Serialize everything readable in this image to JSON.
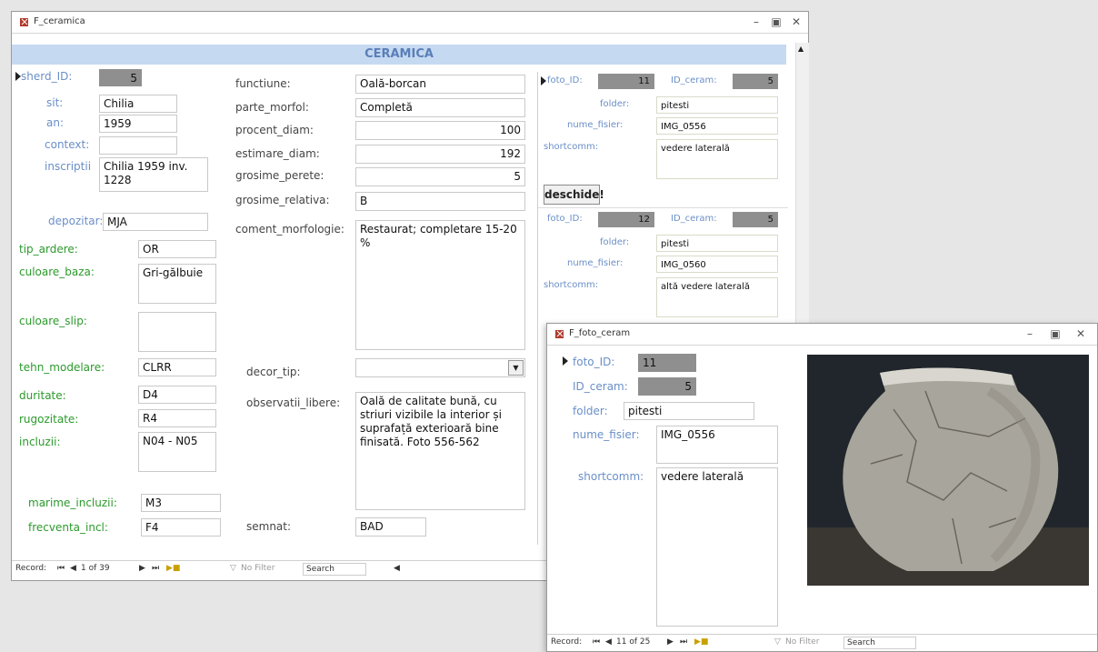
{
  "main_window": {
    "title": "F_ceramica",
    "header": "CERAMICA",
    "fields": {
      "sherd_id_label": "sherd_ID:",
      "sherd_id": "5",
      "sit_label": "sit:",
      "sit": "Chilia",
      "an_label": "an:",
      "an": "1959",
      "context_label": "context:",
      "context": "",
      "inscriptii_label": "inscriptii",
      "inscriptii": "Chilia 1959 inv. 1228",
      "depozitar_label": "depozitar:",
      "depozitar": "MJA",
      "tip_ardere_label": "tip_ardere:",
      "tip_ardere": "OR",
      "culoare_baza_label": "culoare_baza:",
      "culoare_baza": "Gri-gălbuie",
      "culoare_slip_label": "culoare_slip:",
      "culoare_slip": "",
      "tehn_modelare_label": "tehn_modelare:",
      "tehn_modelare": "CLRR",
      "duritate_label": "duritate:",
      "duritate": "D4",
      "rugozitate_label": "rugozitate:",
      "rugozitate": "R4",
      "incluzii_label": "incluzii:",
      "incluzii": "N04 - N05",
      "marime_incluzii_label": "marime_incluzii:",
      "marime_incluzii": "M3",
      "frecventa_incl_label": "frecventa_incl:",
      "frecventa_incl": "F4",
      "functiune_label": "functiune:",
      "functiune": "Oală-borcan",
      "parte_morfol_label": "parte_morfol:",
      "parte_morfol": "Completă",
      "procent_diam_label": "procent_diam:",
      "procent_diam": "100",
      "estimare_diam_label": "estimare_diam:",
      "estimare_diam": "192",
      "grosime_perete_label": "grosime_perete:",
      "grosime_perete": "5",
      "grosime_relativa_label": "grosime_relativa:",
      "grosime_relativa": "B",
      "coment_morfologie_label": "coment_morfologie:",
      "coment_morfologie": "Restaurat; completare 15-20 %",
      "decor_tip_label": "decor_tip:",
      "decor_tip": "",
      "observatii_libere_label": "observatii_libere:",
      "observatii_libere": "Oală de calitate bună, cu striuri vizibile la interior și suprafață exterioară bine finisată. Foto 556-562",
      "semnat_label": "semnat:",
      "semnat": "BAD"
    },
    "subform": {
      "records": [
        {
          "foto_id_label": "foto_ID:",
          "foto_id": "11",
          "id_ceram_label": "ID_ceram:",
          "id_ceram": "5",
          "folder_label": "folder:",
          "folder": "pitesti",
          "nume_fisier_label": "nume_fisier:",
          "nume_fisier": "IMG_0556",
          "shortcomm_label": "shortcomm:",
          "shortcomm": "vedere laterală"
        },
        {
          "foto_id_label": "foto_ID:",
          "foto_id": "12",
          "id_ceram_label": "ID_ceram:",
          "id_ceram": "5",
          "folder_label": "folder:",
          "folder": "pitesti",
          "nume_fisier_label": "nume_fisier:",
          "nume_fisier": "IMG_0560",
          "shortcomm_label": "shortcomm:",
          "shortcomm": "altă vedere laterală"
        }
      ],
      "button_label": "deschide!"
    },
    "navbar": {
      "record_label": "Record:",
      "position": "1 of 39",
      "no_filter": "No Filter",
      "search": "Search"
    }
  },
  "photo_window": {
    "title": "F_foto_ceram",
    "foto_id_label": "foto_ID:",
    "foto_id": "11",
    "id_ceram_label": "ID_ceram:",
    "id_ceram": "5",
    "folder_label": "folder:",
    "folder": "pitesti",
    "nume_fisier_label": "nume_fisier:",
    "nume_fisier": "IMG_0556",
    "shortcomm_label": "shortcomm:",
    "shortcomm": "vedere laterală",
    "navbar": {
      "record_label": "Record:",
      "position": "11 of 25",
      "no_filter": "No Filter",
      "search": "Search"
    }
  },
  "colors": {
    "header_bg": "#c5d9f1",
    "label_blue": "#6a8fc8",
    "label_green": "#2b9a2b",
    "id_field_gray": "#8f8f8f"
  },
  "icons": [
    "access-form-icon",
    "minimize-icon",
    "maximize-icon",
    "close-icon",
    "record-selector-icon",
    "dropdown-arrow-icon"
  ]
}
